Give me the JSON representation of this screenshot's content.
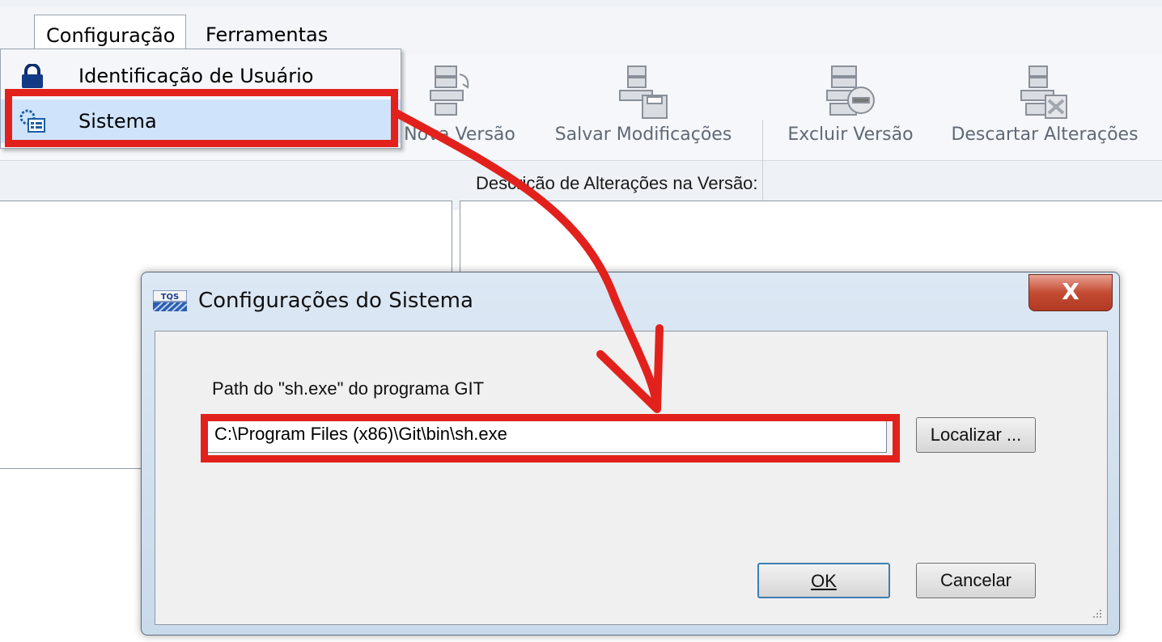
{
  "menubar": {
    "tabs": [
      {
        "label": "Configuração"
      },
      {
        "label": "Ferramentas"
      }
    ]
  },
  "dropdown": {
    "items": [
      {
        "label": "Identificação de Usuário",
        "icon": "lock-icon"
      },
      {
        "label": "Sistema",
        "icon": "system-settings-icon"
      }
    ]
  },
  "ribbon": {
    "buttons": [
      {
        "label": "Nova Versão",
        "icon": "new-version-icon"
      },
      {
        "label": "Salvar Modificações",
        "icon": "save-changes-icon"
      },
      {
        "label": "Excluir Versão",
        "icon": "delete-version-icon"
      },
      {
        "label": "Descartar Alterações",
        "icon": "discard-changes-icon"
      }
    ],
    "desc_label": "Descrição de Alterações na Versão:"
  },
  "dialog": {
    "title": "Configurações do Sistema",
    "logo_text": "TQS",
    "close_label": "X",
    "path_label": "Path do \"sh.exe\" do programa GIT",
    "path_value": "C:\\Program Files (x86)\\Git\\bin\\sh.exe",
    "browse_label": "Localizar ...",
    "ok_label": "OK",
    "cancel_label": "Cancelar"
  },
  "colors": {
    "highlight_red": "#e2211c",
    "menu_highlight": "#cfe4fb",
    "dialog_frame": "#c9daeb"
  }
}
